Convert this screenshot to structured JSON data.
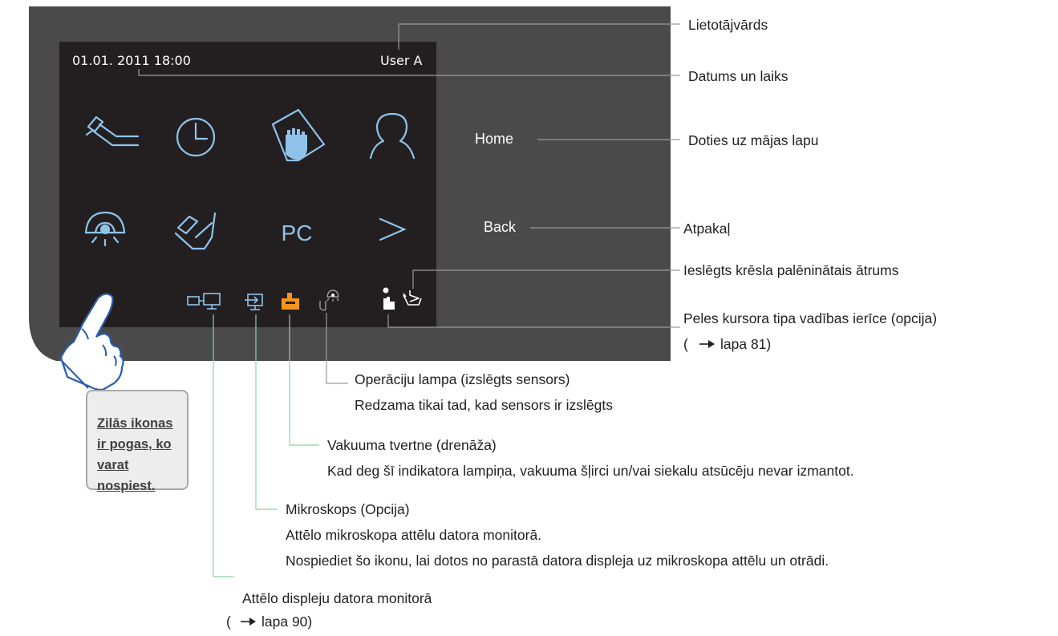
{
  "screen": {
    "datetime": "01.01. 2011 18:00",
    "user": "User A",
    "pc_label": "PC"
  },
  "buttons": {
    "home": "Home",
    "back": "Back"
  },
  "callouts": {
    "username": "Lietotājvārds",
    "datetime": "Datums un laiks",
    "home": "Doties uz mājas lapu",
    "back": "Atpakaļ",
    "slow_speed": "Ieslēgts krēsla palēninātais ātrums",
    "mouse_device": "Peles kursora tipa vadības ierīce (opcija)",
    "mouse_page": "lapa 81)",
    "op_lamp_1": "Operāciju lampa (izslēgts sensors)",
    "op_lamp_2": "Redzama tikai tad, kad sensors ir izslēgts",
    "vacuum_1": "Vakuuma tvertne (drenāža)",
    "vacuum_2": "Kad deg šī indikatora lampiņa, vakuuma šļirci un/vai siekalu atsūcēju nevar izmantot.",
    "microscope_1": "Mikroskops (Opcija)",
    "microscope_2": "Attēlo mikroskopa attēlu datora monitorā.",
    "microscope_3": "Nospiediet šo ikonu, lai dotos no parastā datora displeja uz mikroskopa attēlu un otrādi.",
    "monitor_1": "Attēlo displeju datora monitorā",
    "monitor_page": "lapa 90)",
    "paren_open": "("
  },
  "note": "Zilās ikonas ir pogas, ko varat nospiest.",
  "colors": {
    "panel": "#4a4a4a",
    "screen": "#231f20",
    "icon_blue": "#8fc3ea",
    "icon_orange": "#f7941d",
    "leader_green": "#8dd0a5",
    "leader_gray": "#9a9a9a"
  },
  "icons": [
    "handpiece-icon",
    "clock-icon",
    "hand-touch-icon",
    "user-icon",
    "operating-lamp-icon",
    "foot-pedal-icon",
    "next-icon",
    "monitor-display-icon",
    "microscope-icon",
    "vacuum-tank-icon",
    "lamp-sensor-off-icon",
    "mouse-device-icon",
    "chair-slow-icon",
    "pointing-hand-icon"
  ]
}
